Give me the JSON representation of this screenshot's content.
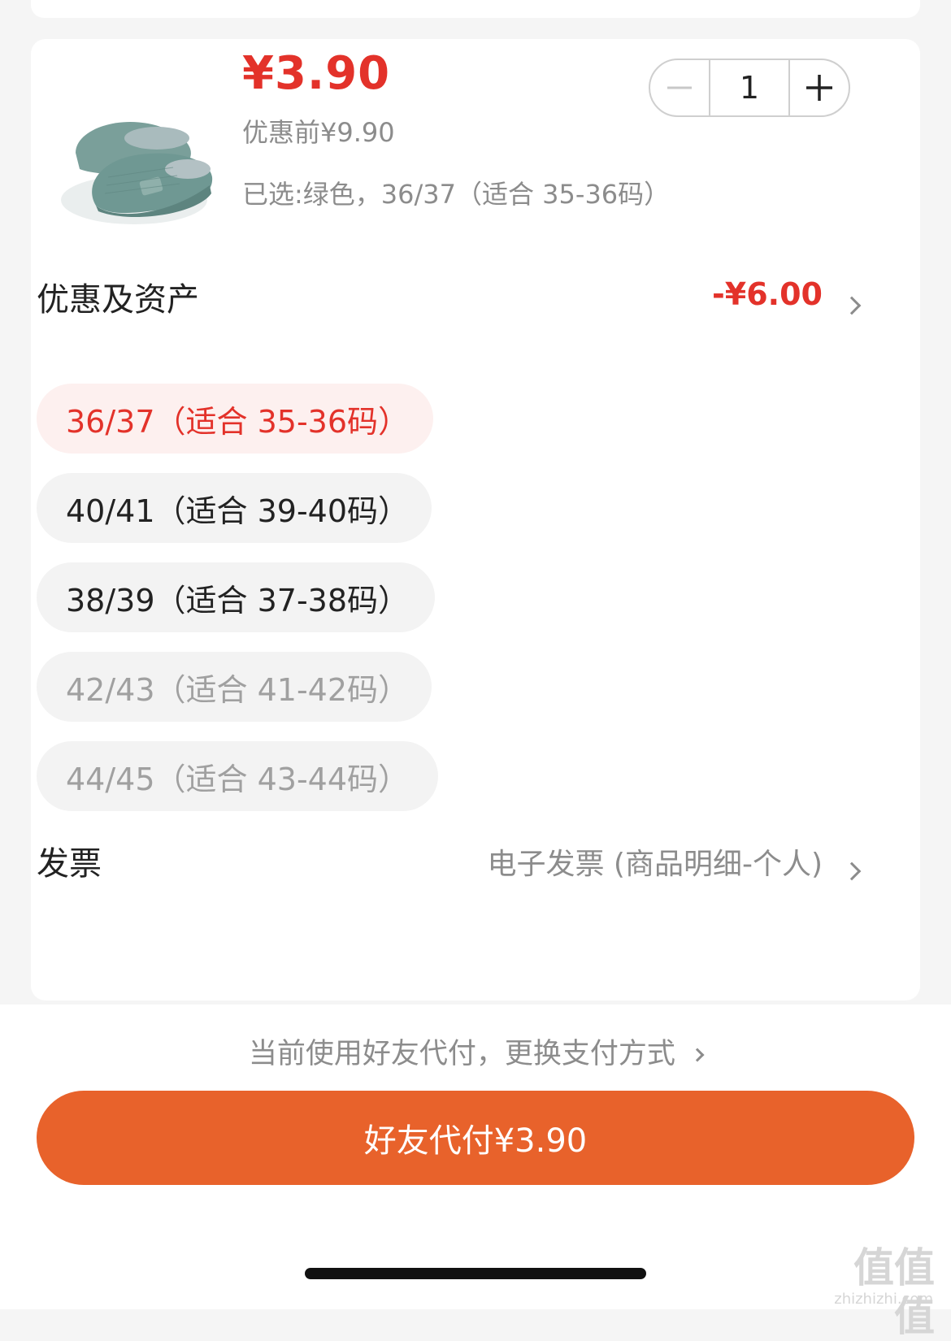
{
  "product": {
    "price": "¥3.90",
    "original_price": "优惠前¥9.90",
    "selected_spec": "已选:绿色，36/37（适合 35-36码）",
    "image_icon": "slipper-image"
  },
  "quantity": {
    "value": "1"
  },
  "discount": {
    "label": "优惠及资产",
    "value": "-¥6.00"
  },
  "sizes": [
    {
      "label": "36/37（适合 35-36码）",
      "state": "active"
    },
    {
      "label": "40/41（适合 39-40码）",
      "state": "normal"
    },
    {
      "label": "38/39（适合 37-38码）",
      "state": "normal"
    },
    {
      "label": "42/43（适合 41-42码）",
      "state": "disabled"
    },
    {
      "label": "44/45（适合 43-44码）",
      "state": "disabled"
    }
  ],
  "invoice": {
    "label": "发票",
    "value": "电子发票 (商品明细-个人)"
  },
  "footer": {
    "pay_hint": "当前使用好友代付，更换支付方式",
    "pay_button": "好友代付¥3.90"
  },
  "colors": {
    "accent_red": "#e3322a",
    "button_orange": "#e8622b",
    "active_chip_bg": "#fdf0ef"
  },
  "watermark": {
    "logo": "值值值",
    "url": "zhizhizhi.com"
  }
}
